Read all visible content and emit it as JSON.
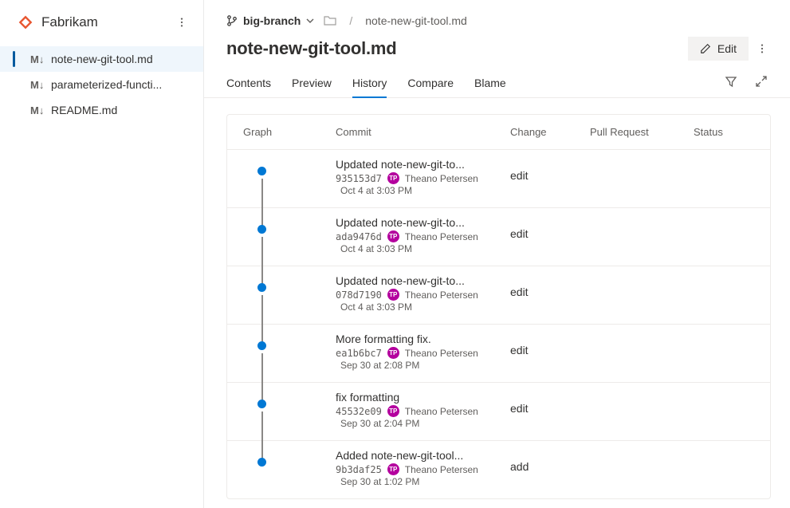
{
  "brand": {
    "name": "Fabrikam"
  },
  "files": [
    {
      "name": "note-new-git-tool.md",
      "active": true
    },
    {
      "name": "parameterized-functi...",
      "active": false
    },
    {
      "name": "README.md",
      "active": false
    }
  ],
  "branch": {
    "name": "big-branch"
  },
  "breadcrumb": {
    "file": "note-new-git-tool.md"
  },
  "page": {
    "title": "note-new-git-tool.md"
  },
  "actions": {
    "edit": "Edit"
  },
  "tabs": [
    {
      "label": "Contents",
      "active": false
    },
    {
      "label": "Preview",
      "active": false
    },
    {
      "label": "History",
      "active": true
    },
    {
      "label": "Compare",
      "active": false
    },
    {
      "label": "Blame",
      "active": false
    }
  ],
  "history": {
    "headers": {
      "graph": "Graph",
      "commit": "Commit",
      "change": "Change",
      "pr": "Pull Request",
      "status": "Status"
    },
    "rows": [
      {
        "title": "Updated note-new-git-to...",
        "hash": "935153d7",
        "author": "Theano Petersen",
        "date": "Oct 4 at 3:03 PM",
        "change": "edit",
        "first": true,
        "last": false
      },
      {
        "title": "Updated note-new-git-to...",
        "hash": "ada9476d",
        "author": "Theano Petersen",
        "date": "Oct 4 at 3:03 PM",
        "change": "edit",
        "first": false,
        "last": false
      },
      {
        "title": "Updated note-new-git-to...",
        "hash": "078d7190",
        "author": "Theano Petersen",
        "date": "Oct 4 at 3:03 PM",
        "change": "edit",
        "first": false,
        "last": false
      },
      {
        "title": "More formatting fix.",
        "hash": "ea1b6bc7",
        "author": "Theano Petersen",
        "date": "Sep 30 at 2:08 PM",
        "change": "edit",
        "first": false,
        "last": false
      },
      {
        "title": "fix formatting",
        "hash": "45532e09",
        "author": "Theano Petersen",
        "date": "Sep 30 at 2:04 PM",
        "change": "edit",
        "first": false,
        "last": false
      },
      {
        "title": "Added note-new-git-tool...",
        "hash": "9b3daf25",
        "author": "Theano Petersen",
        "date": "Sep 30 at 1:02 PM",
        "change": "add",
        "first": false,
        "last": true
      }
    ]
  },
  "avatar_initials": "TP"
}
